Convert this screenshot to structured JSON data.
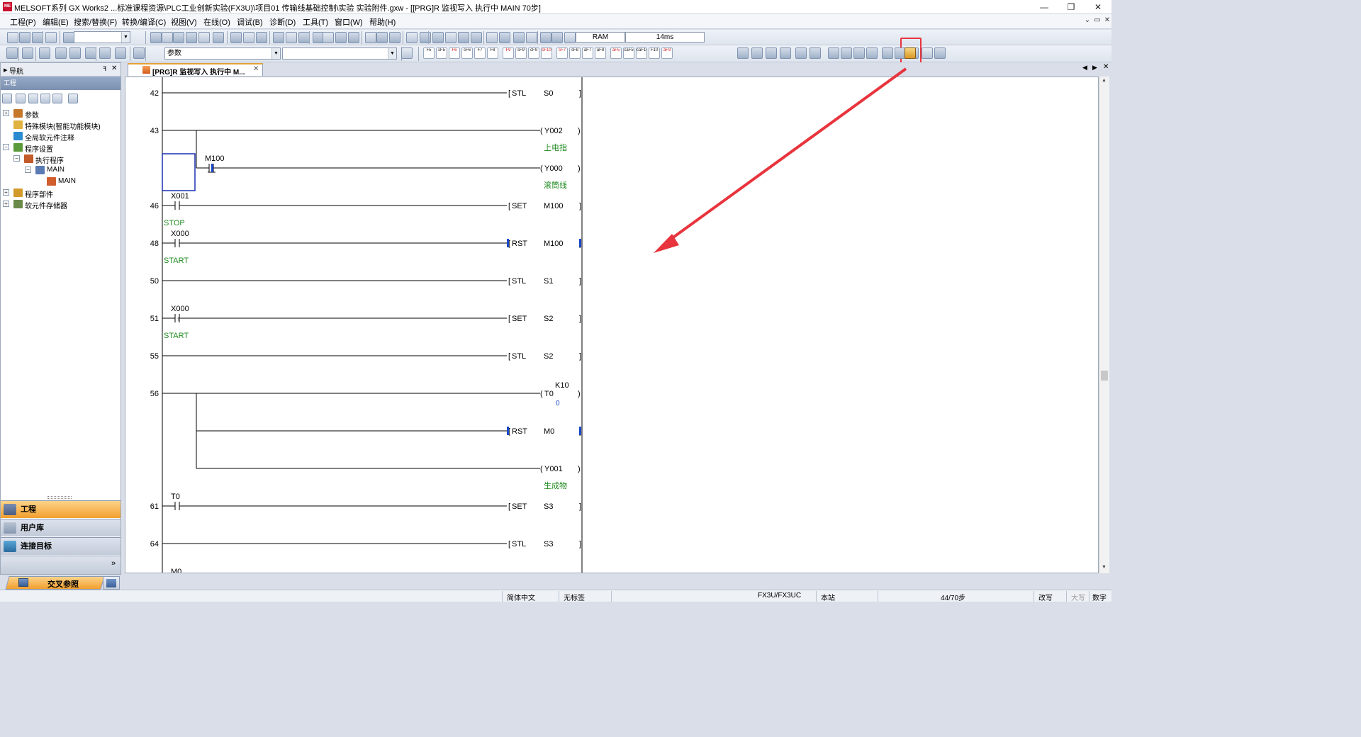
{
  "window": {
    "title": "MELSOFT系列 GX Works2 ...标准课程资源\\PLC工业创新实验(FX3U)\\项目01 传输线基础控制\\实验 实验附件.gxw - [[PRG]R 监视写入 执行中 MAIN 70步]",
    "app_icon": "MELSOFT-app-icon",
    "minimize": "—",
    "restore": "❐",
    "close": "✕"
  },
  "menubar": {
    "items": [
      "工程(P)",
      "编辑(E)",
      "搜索/替换(F)",
      "转换/编译(C)",
      "视图(V)",
      "在线(O)",
      "调试(B)",
      "诊断(D)",
      "工具(T)",
      "窗口(W)",
      "帮助(H)"
    ],
    "mdi_minimize": "⌄",
    "mdi_restore": "▭",
    "mdi_close": "✕"
  },
  "toolbar1": {
    "ram_label": "RAM",
    "scan_label": "14ms"
  },
  "toolbar2": {
    "combo_value": "参数",
    "fkeys": [
      "F5",
      "sF5",
      "F6",
      "sF6",
      "F7",
      "F8",
      "F9",
      "sF9",
      "cF9",
      "cF10",
      "sF7",
      "sF8",
      "aF7",
      "aF8",
      "aF5",
      "caF5",
      "caF10",
      "F10",
      "aF9"
    ],
    "fkey_colors": [
      "#1a1a1a",
      "#d22020"
    ],
    "highlighted_button_icon": "monitor-write-mode-icon",
    "highlight_color": "#e8343d"
  },
  "nav": {
    "header": "导航",
    "pin": "ꟻ",
    "close": "✕",
    "subheader": "工程",
    "tree": [
      {
        "label": "参数",
        "expand": "+",
        "icon": "parameter-icon"
      },
      {
        "label": "特殊模块(智能功能模块)",
        "expand": "",
        "icon": "intelligent-module-icon"
      },
      {
        "label": "全局软元件注释",
        "expand": "",
        "icon": "global-comment-icon"
      },
      {
        "label": "程序设置",
        "expand": "−",
        "icon": "program-setting-icon"
      },
      {
        "label": "执行程序",
        "expand": "−",
        "icon": "execute-program-icon"
      },
      {
        "label": "MAIN",
        "expand": "−",
        "icon": "main-program-icon"
      },
      {
        "label": "MAIN",
        "expand": "",
        "icon": "ladder-file-icon"
      },
      {
        "label": "程序部件",
        "expand": "+",
        "icon": "program-parts-icon"
      },
      {
        "label": "软元件存储器",
        "expand": "+",
        "icon": "device-memory-icon"
      }
    ],
    "buttons": [
      {
        "label": "工程",
        "active": true
      },
      {
        "label": "用户库",
        "active": false
      },
      {
        "label": "连接目标",
        "active": false
      }
    ],
    "more": "»"
  },
  "doc_tab": {
    "label": "[PRG]R 监视写入 执行中 M...",
    "close": "✕"
  },
  "tab_nav": {
    "prev": "◀",
    "next": "▶",
    "close": "✕"
  },
  "bottom_tab": {
    "label": "交叉参照"
  },
  "ladder": {
    "rungs": [
      {
        "step": "42",
        "instr": "STL",
        "operand": "S0",
        "comment": "",
        "type": "apply"
      },
      {
        "step": "43",
        "coil": "Y002",
        "comment": "上电指",
        "type": "coil"
      },
      {
        "step": "",
        "contact": "M100",
        "coil": "Y000",
        "comment": "滚筒线",
        "type": "coil-falling-branch"
      },
      {
        "step": "46",
        "contact": "X001",
        "contact_comment": "STOP",
        "instr": "SET",
        "operand": "M100",
        "type": "apply"
      },
      {
        "step": "48",
        "contact": "X000",
        "contact_comment": "START",
        "instr": "RST",
        "operand": "M100",
        "type": "apply"
      },
      {
        "step": "50",
        "instr": "STL",
        "operand": "S1",
        "type": "apply"
      },
      {
        "step": "51",
        "contact": "X000",
        "contact_comment": "START",
        "instr": "SET",
        "operand": "S2",
        "type": "apply"
      },
      {
        "step": "55",
        "instr": "STL",
        "operand": "S2",
        "type": "apply"
      },
      {
        "step": "56",
        "coil": "T0",
        "setting": "K10",
        "current": "0",
        "type": "timer"
      },
      {
        "step": "",
        "instr": "RST",
        "operand": "M0",
        "type": "branch-apply"
      },
      {
        "step": "",
        "coil": "Y001",
        "comment": "生成物",
        "type": "branch-coil"
      },
      {
        "step": "61",
        "contact": "T0",
        "instr": "SET",
        "operand": "S3",
        "type": "apply"
      },
      {
        "step": "64",
        "instr": "STL",
        "operand": "S3",
        "type": "apply"
      },
      {
        "step": "",
        "contact": "M0",
        "type": "partial"
      }
    ],
    "comment_color": "#1f8a1f",
    "value_color": "#1a47c8",
    "arrow_color": "#e8343d"
  },
  "status": {
    "lang": "简体中文",
    "tag": "无标签",
    "cpu": "FX3U/FX3UC",
    "station": "本站",
    "steps": "44/70步",
    "mode": "改写",
    "caps": "大写",
    "num": "数字"
  }
}
